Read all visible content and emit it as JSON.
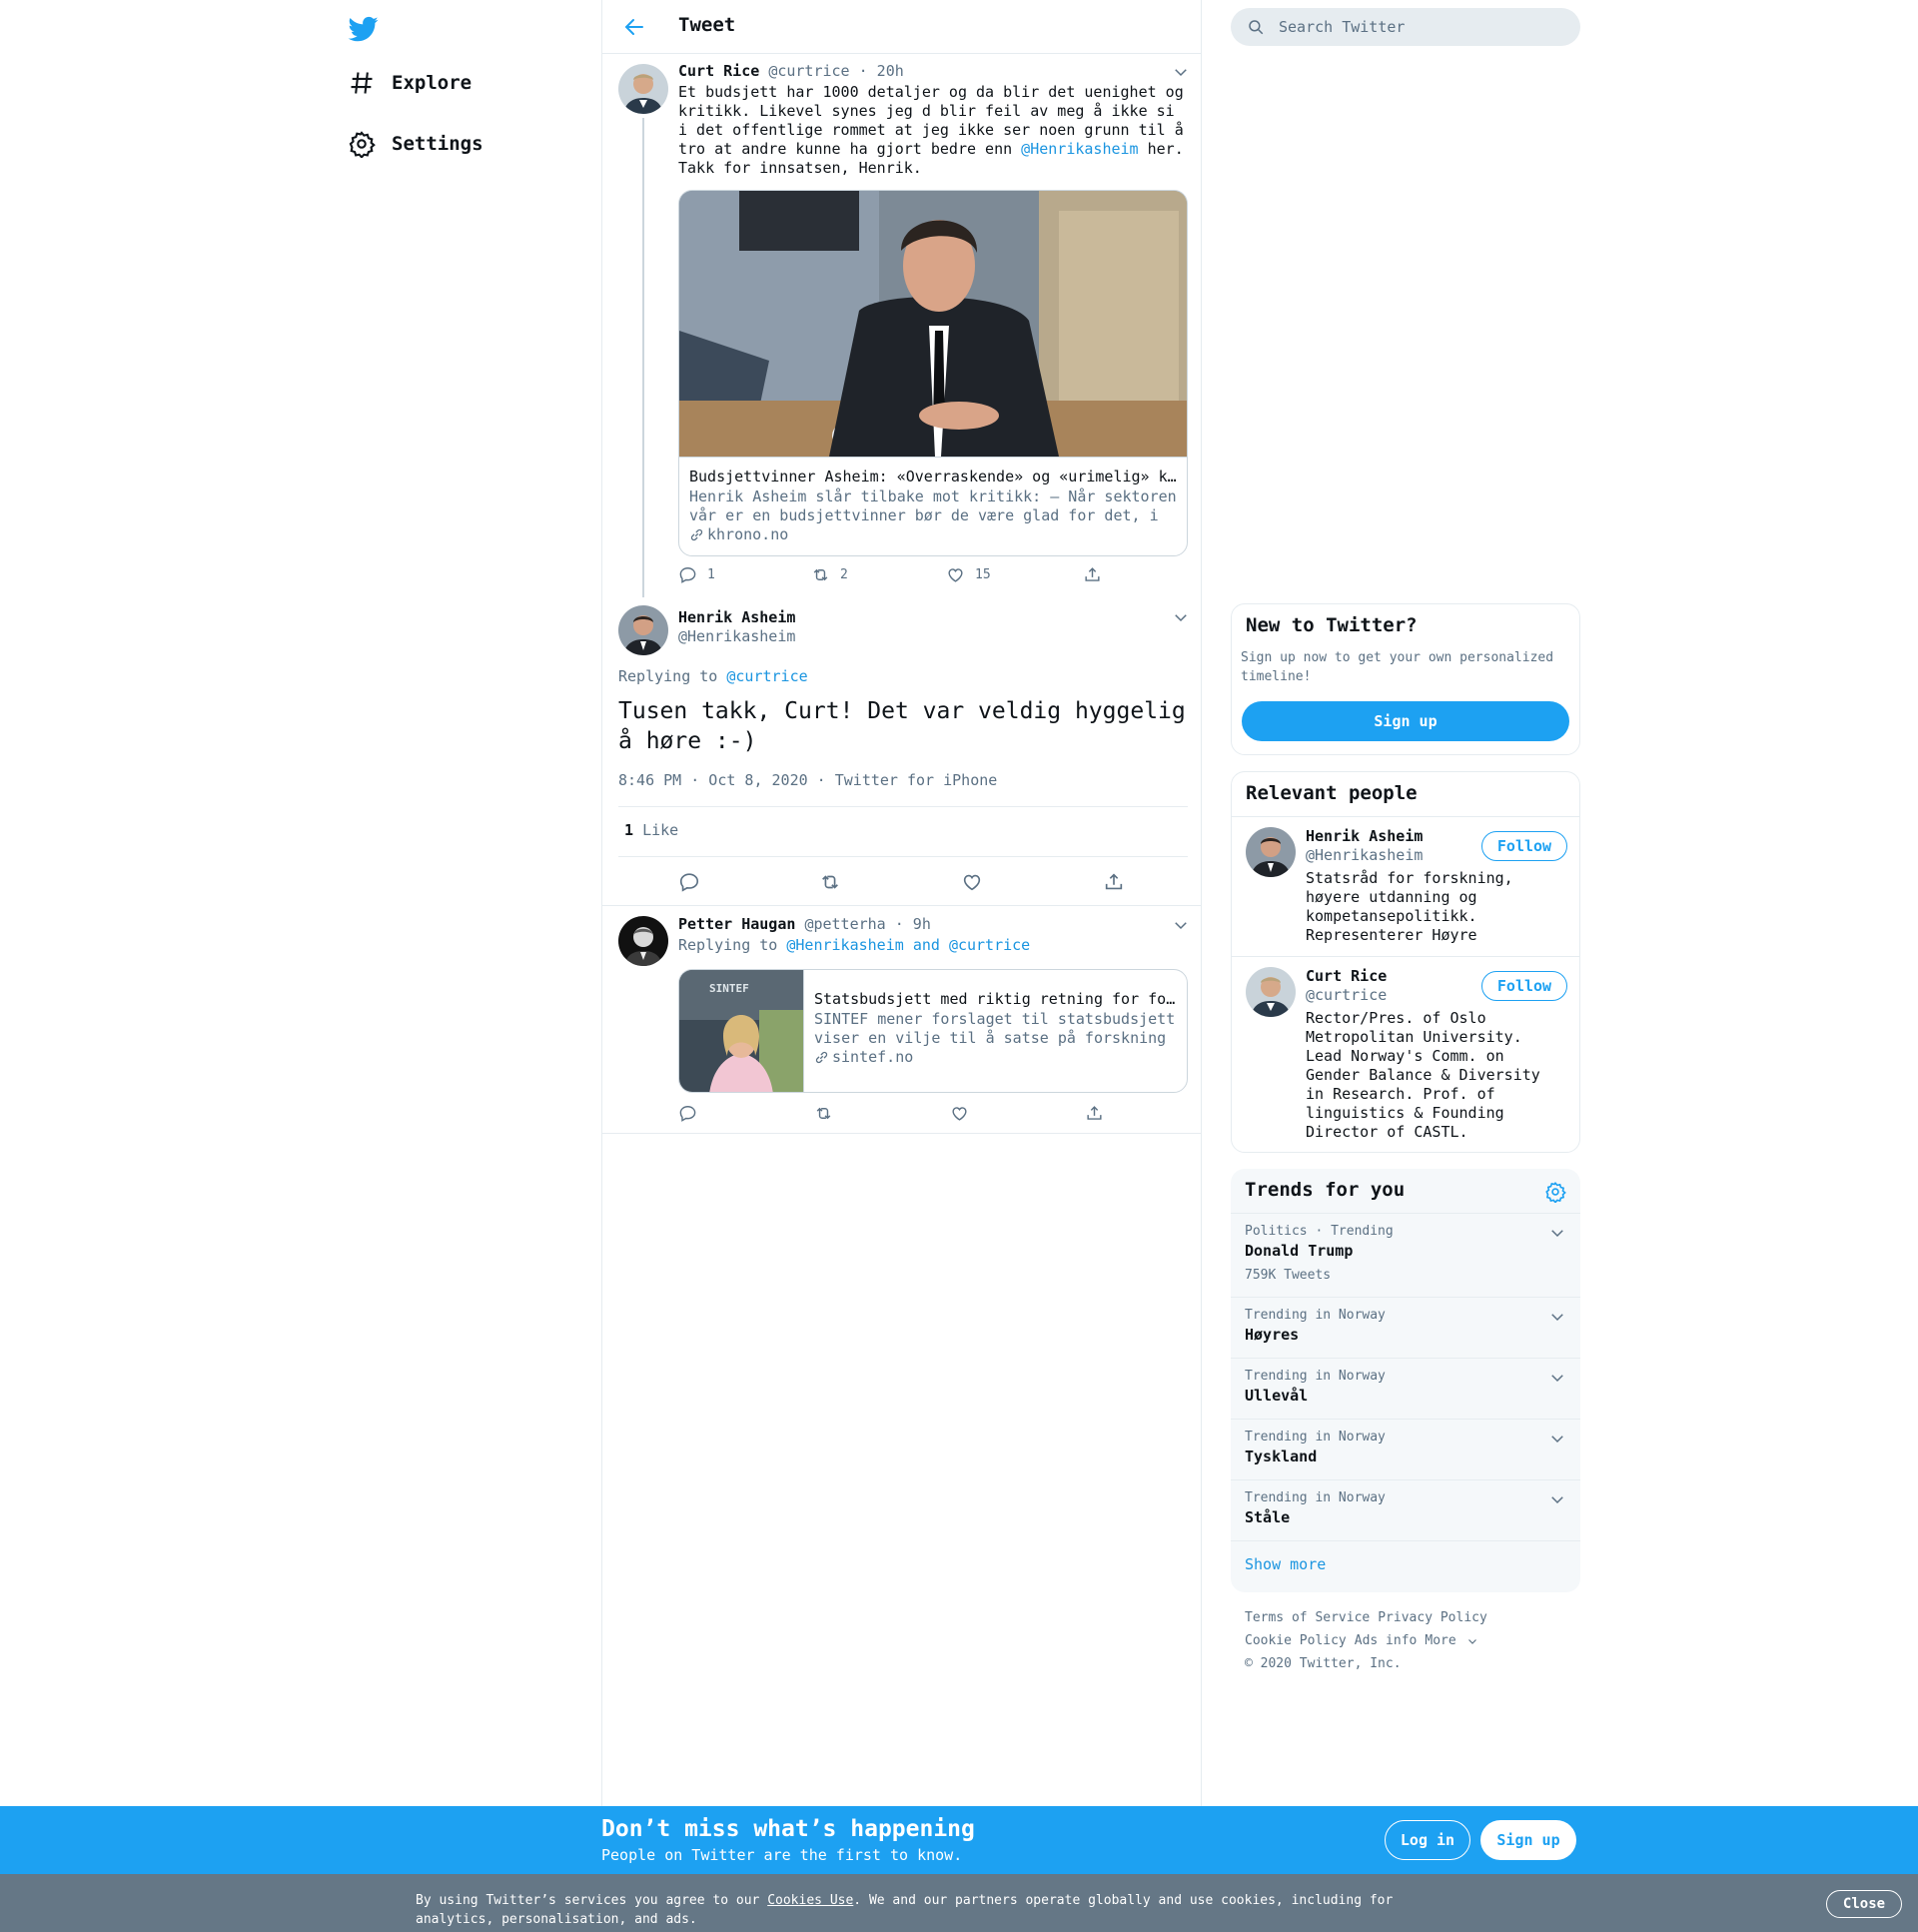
{
  "nav": {
    "explore": "Explore",
    "settings": "Settings"
  },
  "header": {
    "title": "Tweet"
  },
  "search": {
    "placeholder": "Search Twitter"
  },
  "tweet1": {
    "name": "Curt Rice",
    "handle": "@curtrice",
    "time": "· 20h",
    "text_before": "Et budsjett har 1000 detaljer og da blir det uenighet og kritikk. Likevel synes jeg d blir feil av meg å ikke si i det offentlige rommet at jeg ikke ser noen grunn til å tro at andre kunne ha gjort bedre enn ",
    "mention": "@Henrikasheim",
    "text_after": " her. Takk for innsatsen, Henrik.",
    "card": {
      "title": "Budsjettvinner Asheim: «Overraskende» og «urimelig» kritikk",
      "description": "Henrik Asheim slår tilbake mot kritikk: — Når sektoren vår er en budsjettvinner bør de være glad for det, i stedet for å klage",
      "domain": "khrono.no"
    },
    "replies": "1",
    "retweets": "2",
    "likes": "15"
  },
  "tweet2": {
    "name": "Henrik Asheim",
    "handle": "@Henrikasheim",
    "replying_label": "Replying to",
    "replying_to": "@curtrice",
    "text": "Tusen takk, Curt! Det var veldig hyggelig å høre :-)",
    "timestamp": "8:46 PM · Oct 8, 2020",
    "source": "Twitter for iPhone",
    "like_count": "1",
    "like_label": "Like"
  },
  "tweet3": {
    "name": "Petter Haugan",
    "handle": "@petterha",
    "time": "· 9h",
    "replying_label": "Replying to",
    "replying_to_1": "@Henrikasheim",
    "replying_and": "and",
    "replying_to_2": "@curtrice",
    "card": {
      "title": "Statsbudsjett med riktig retning for forskning",
      "description": "SINTEF mener forslaget til statsbudsjett viser en vilje til å satse på forskning og innovasjon",
      "domain": "sintef.no",
      "image_text": "SINTEF"
    }
  },
  "new_to_twitter": {
    "title": "New to Twitter?",
    "text": "Sign up now to get your own personalized timeline!",
    "button": "Sign up"
  },
  "relevant": {
    "title": "Relevant people",
    "people": [
      {
        "name": "Henrik Asheim",
        "handle": "@Henrikasheim",
        "bio": "Statsråd for forskning, høyere utdanning og kompetansepolitikk. Representerer Høyre",
        "button": "Follow"
      },
      {
        "name": "Curt Rice",
        "handle": "@curtrice",
        "bio": "Rector/Pres. of Oslo Metropolitan University. Lead Norway's Comm. on Gender Balance & Diversity in Research. Prof. of linguistics & Founding Director of CASTL.",
        "button": "Follow"
      }
    ]
  },
  "trends": {
    "title": "Trends for you",
    "items": [
      {
        "context": "Politics · Trending",
        "name": "Donald Trump",
        "count": "759K Tweets"
      },
      {
        "context": "Trending in Norway",
        "name": "Høyres"
      },
      {
        "context": "Trending in Norway",
        "name": "Ullevål"
      },
      {
        "context": "Trending in Norway",
        "name": "Tyskland"
      },
      {
        "context": "Trending in Norway",
        "name": "Ståle"
      }
    ],
    "show_more": "Show more"
  },
  "footer": {
    "terms": "Terms of Service",
    "privacy": "Privacy Policy",
    "cookie": "Cookie Policy",
    "ads": "Ads info",
    "more": "More",
    "copyright": "© 2020 Twitter, Inc."
  },
  "bottom_bar": {
    "title": "Don’t miss what’s happening",
    "subtitle": "People on Twitter are the first to know.",
    "login": "Log in",
    "signup": "Sign up"
  },
  "cookie_bar": {
    "text_before": "By using Twitter’s services you agree to our ",
    "link": "Cookies Use",
    "text_after": ". We and our partners operate globally and use cookies, including for analytics, personalisation, and ads.",
    "close": "Close"
  },
  "colors": {
    "accent": "#1da1f2",
    "link": "#1b95e0",
    "muted": "#5b7083",
    "border": "#e6ecf0",
    "cookie_bar": "#657786"
  }
}
